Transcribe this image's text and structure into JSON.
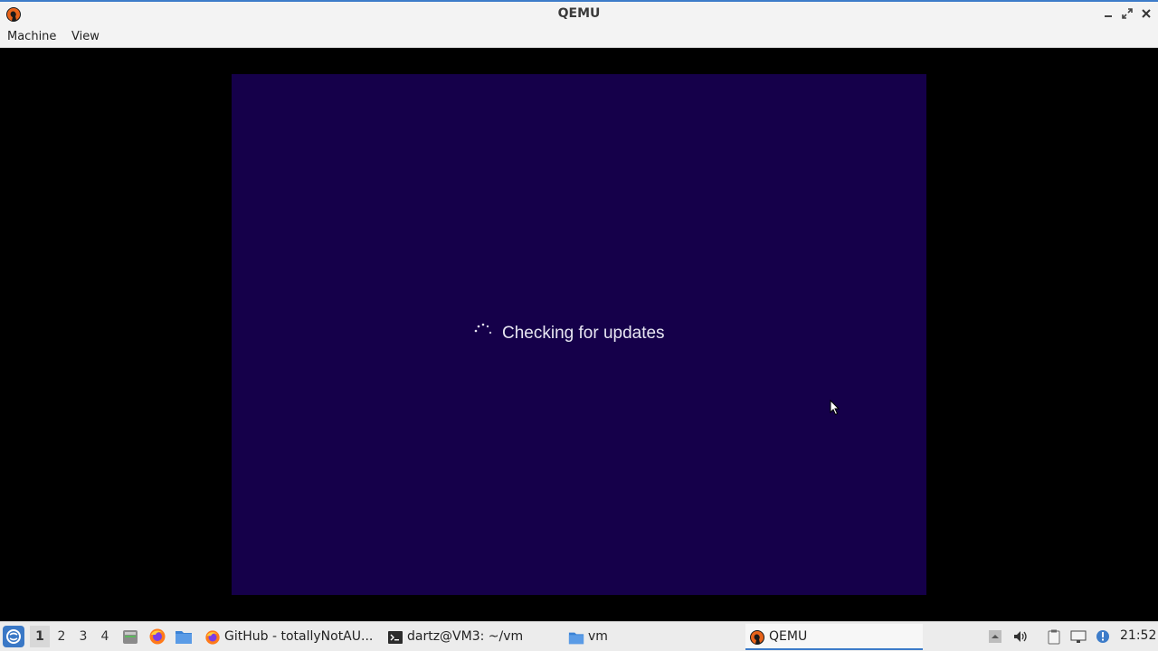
{
  "window": {
    "title": "QEMU",
    "app_icon": "qemu-icon",
    "controls": [
      "minimize-icon",
      "maximize-icon",
      "close-icon"
    ]
  },
  "menubar": {
    "machine_label": "Machine",
    "view_label": "View"
  },
  "guest": {
    "status_text": "Checking for updates",
    "background_color": "#15004a",
    "spinner_icon": "loading-spinner-icon",
    "cursor_icon": "mouse-pointer-icon"
  },
  "taskbar": {
    "start_icon": "start-menu-icon",
    "workspaces": [
      "1",
      "2",
      "3",
      "4"
    ],
    "active_workspace": "1",
    "launchers": [
      "file-manager-icon",
      "firefox-icon",
      "folder-icon"
    ],
    "tasks": [
      {
        "label": "GitHub - totallyNotAU...",
        "icon": "firefox-icon"
      },
      {
        "label": "dartz@VM3: ~/vm",
        "icon": "terminal-icon"
      },
      {
        "label": "vm",
        "icon": "folder-icon"
      },
      {
        "label": "QEMU",
        "icon": "qemu-icon",
        "active": true
      }
    ],
    "tray_icons": [
      "tray-expand-icon",
      "volume-icon",
      "clipboard-icon",
      "network-icon",
      "update-notifier-icon"
    ],
    "clock": "21:52"
  },
  "colors": {
    "accent": "#3d7cc9",
    "guest_bg": "#15004a",
    "titlebar_bg": "#f3f3f3"
  }
}
